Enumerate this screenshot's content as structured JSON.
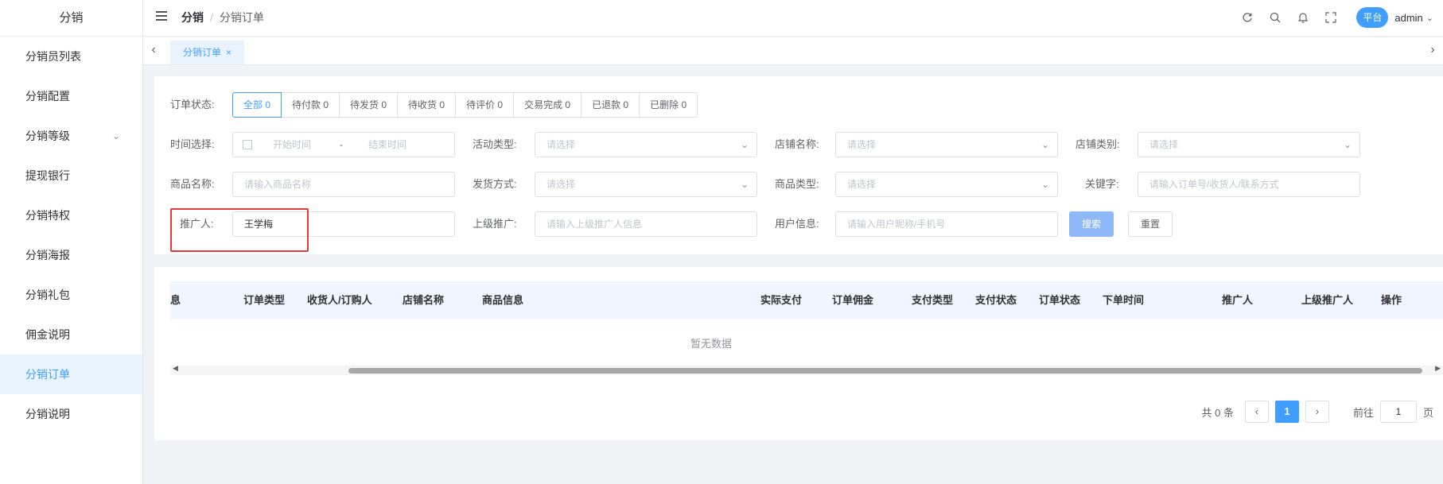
{
  "sidebar": {
    "title": "分销",
    "items": [
      {
        "label": "分销员列表"
      },
      {
        "label": "分销配置"
      },
      {
        "label": "分销等级"
      },
      {
        "label": "提现银行"
      },
      {
        "label": "分销特权"
      },
      {
        "label": "分销海报"
      },
      {
        "label": "分销礼包"
      },
      {
        "label": "佣金说明"
      },
      {
        "label": "分销订单"
      },
      {
        "label": "分销说明"
      }
    ],
    "active_index": 8
  },
  "header": {
    "breadcrumb": [
      "分销",
      "分销订单"
    ],
    "separator": "/",
    "avatar_label": "平台",
    "user": "admin"
  },
  "tabs": [
    {
      "label": "分销订单"
    }
  ],
  "filters": {
    "order_status_label": "订单状态:",
    "order_status": [
      "全部 0",
      "待付款 0",
      "待发货 0",
      "待收货 0",
      "待评价 0",
      "交易完成 0",
      "已退款 0",
      "已删除 0"
    ],
    "time_label": "时间选择:",
    "time_start_placeholder": "开始时间",
    "time_range_sep": "-",
    "time_end_placeholder": "结束时间",
    "activity_type_label": "活动类型:",
    "activity_type_placeholder": "请选择",
    "shop_name_label": "店铺名称:",
    "shop_name_placeholder": "请选择",
    "shop_category_label": "店铺类别:",
    "shop_category_placeholder": "请选择",
    "product_name_label": "商品名称:",
    "product_name_placeholder": "请输入商品名称",
    "delivery_label": "发货方式:",
    "delivery_placeholder": "请选择",
    "product_type_label": "商品类型:",
    "product_type_placeholder": "请选择",
    "keyword_label": "关键字:",
    "keyword_placeholder": "请输入订单号/收货人/联系方式",
    "promoter_label": "推广人:",
    "promoter_value": "王学梅",
    "superior_label": "上级推广:",
    "superior_placeholder": "请输入上级推广人信息",
    "user_info_label": "用户信息:",
    "user_info_placeholder": "请输入用户昵称/手机号",
    "search_label": "搜索",
    "reset_label": "重置"
  },
  "table": {
    "columns": [
      "息",
      "订单类型",
      "收货人/订购人",
      "店铺名称",
      "商品信息",
      "实际支付",
      "订单佣金",
      "支付类型",
      "支付状态",
      "订单状态",
      "下单时间",
      "推广人",
      "上级推广人",
      "操作"
    ],
    "rows": [],
    "empty_text": "暂无数据"
  },
  "pagination": {
    "total_text": "共 0 条",
    "current_page": "1",
    "goto_label": "前往",
    "goto_value": "1",
    "page_unit": "页"
  },
  "colors": {
    "primary": "#409eff",
    "highlight": "#e53935"
  }
}
